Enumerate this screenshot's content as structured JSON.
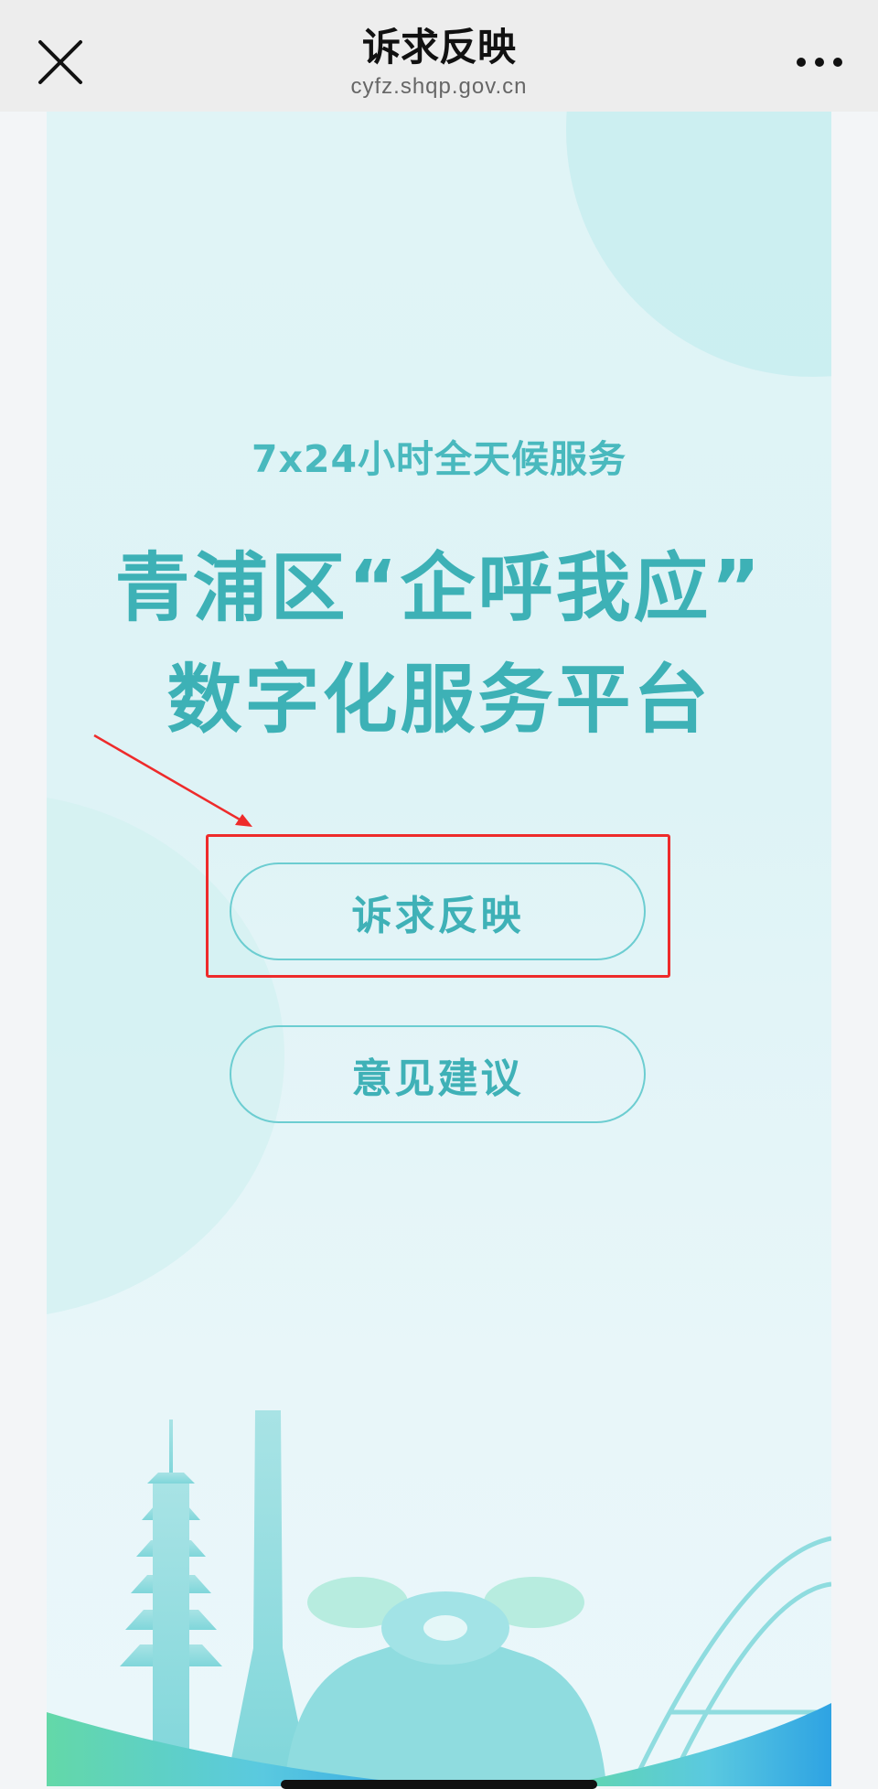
{
  "topbar": {
    "title": "诉求反映",
    "url": "cyfz.shqp.gov.cn",
    "close_icon": "close-icon",
    "more_icon": "more-dots-icon"
  },
  "page": {
    "subtitle": "7x24小时全天候服务",
    "heading_line1": "青浦区“企呼我应”",
    "heading_line2": "数字化服务平台",
    "buttons": [
      {
        "label": "诉求反映",
        "highlighted": true
      },
      {
        "label": "意见建议",
        "highlighted": false
      }
    ]
  },
  "colors": {
    "accent": "#3db1b6",
    "annotation": "#ee2b2b",
    "bar_bg": "#ededed"
  }
}
